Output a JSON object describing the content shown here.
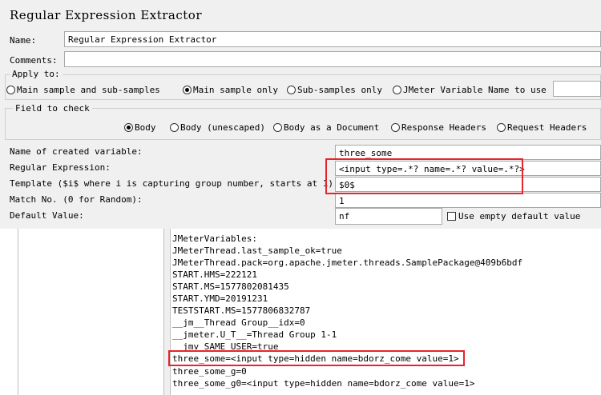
{
  "title": "Regular Expression Extractor",
  "name_label": "Name:",
  "name_value": "Regular Expression Extractor",
  "comments_label": "Comments:",
  "comments_value": "",
  "apply_to": {
    "label": "Apply to:",
    "options": [
      "Main sample and sub-samples",
      "Main sample only",
      "Sub-samples only",
      "JMeter Variable Name to use"
    ],
    "selected": "Main sample only",
    "variable_value": ""
  },
  "field_to_check": {
    "label": "Field to check",
    "options": [
      "Body",
      "Body (unescaped)",
      "Body as a Document",
      "Response Headers",
      "Request Headers"
    ],
    "selected": "Body"
  },
  "form": {
    "created_variable_label": "Name of created variable:",
    "created_variable_value": "three_some",
    "regex_label": "Regular Expression:",
    "regex_value": "<input type=.*? name=.*? value=.*?>",
    "template_label": "Template ($i$ where i is capturing group number, starts at 1):",
    "template_value": "$0$",
    "match_label": "Match No. (0 for Random):",
    "match_value": "1",
    "default_label": "Default Value:",
    "default_value": "nf",
    "use_empty_label": "Use empty default value"
  },
  "log_lines": [
    "JMeterVariables:",
    "JMeterThread.last_sample_ok=true",
    "JMeterThread.pack=org.apache.jmeter.threads.SamplePackage@409b6bdf",
    "START.HMS=222121",
    "START.MS=1577802081435",
    "START.YMD=20191231",
    "TESTSTART.MS=1577806832787",
    "__jm__Thread Group__idx=0",
    "__jmeter.U_T__=Thread Group 1-1",
    "__jmv_SAME_USER=true",
    "three_some=<input type=hidden name=bdorz_come value=1>",
    "three_some_g=0",
    "three_some_g0=<input type=hidden name=bdorz_come value=1>"
  ],
  "highlight_color": "#e8232b"
}
